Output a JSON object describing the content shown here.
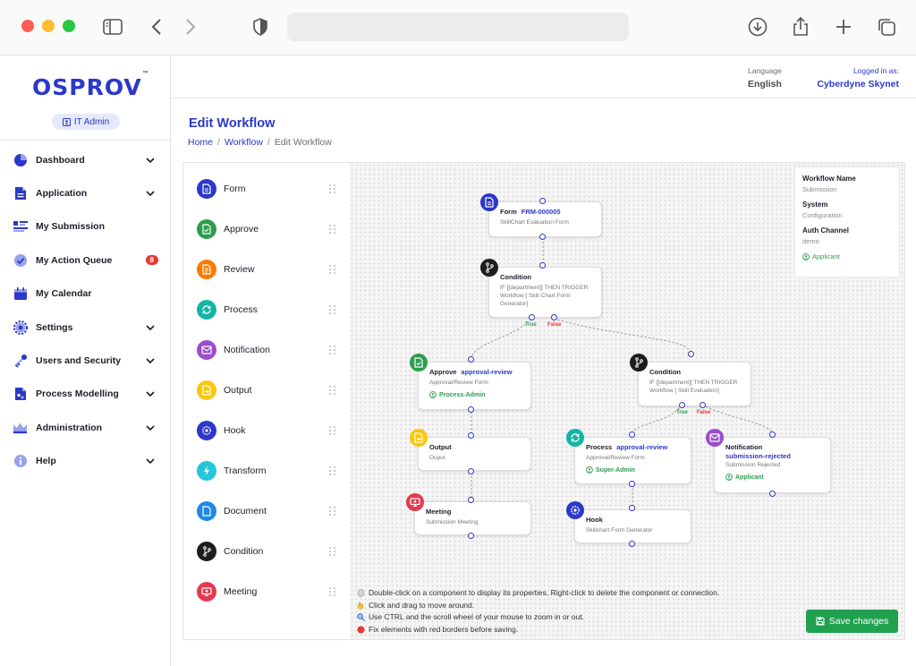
{
  "browser": {
    "icons": [
      "sidebar-icon",
      "back-icon",
      "forward-icon",
      "shield-icon",
      "download-icon",
      "share-icon",
      "new-tab-icon",
      "tabs-icon"
    ]
  },
  "app": {
    "logo": "OSPROV",
    "logo_tm": "™",
    "role": "IT Admin"
  },
  "sidebar": {
    "items": [
      {
        "label": "Dashboard",
        "icon": "pie-chart-icon",
        "chevron": true
      },
      {
        "label": "Application",
        "icon": "document-icon",
        "chevron": true
      },
      {
        "label": "My Submission",
        "icon": "list-icon",
        "chevron": false
      },
      {
        "label": "My Action Queue",
        "icon": "check-circle-icon",
        "badge": "8"
      },
      {
        "label": "My Calendar",
        "icon": "calendar-icon",
        "chevron": false
      },
      {
        "label": "Settings",
        "icon": "gear-icon",
        "chevron": true
      },
      {
        "label": "Users and Security",
        "icon": "key-icon",
        "chevron": true
      },
      {
        "label": "Process Modelling",
        "icon": "flow-icon",
        "chevron": true
      },
      {
        "label": "Administration",
        "icon": "crown-icon",
        "chevron": true
      },
      {
        "label": "Help",
        "icon": "info-icon",
        "chevron": true
      }
    ]
  },
  "header": {
    "language_label": "Language",
    "language_value": "English",
    "logged_label": "Logged in as:",
    "logged_user": "Cyberdyne Skynet"
  },
  "page": {
    "title": "Edit Workflow",
    "breadcrumb": [
      "Home",
      "Workflow",
      "Edit Workflow"
    ]
  },
  "palette": [
    {
      "label": "Form",
      "color": "#2b38c9"
    },
    {
      "label": "Approve",
      "color": "#2e9d4f"
    },
    {
      "label": "Review",
      "color": "#f57c00"
    },
    {
      "label": "Process",
      "color": "#13b5a5"
    },
    {
      "label": "Notification",
      "color": "#9c4dcc"
    },
    {
      "label": "Output",
      "color": "#f9c80e"
    },
    {
      "label": "Hook",
      "color": "#2b38c9"
    },
    {
      "label": "Transform",
      "color": "#26c6da"
    },
    {
      "label": "Document",
      "color": "#1e88e5"
    },
    {
      "label": "Condition",
      "color": "#1d1d1d"
    },
    {
      "label": "Meeting",
      "color": "#e53950"
    }
  ],
  "workflow_info": {
    "name_label": "Workflow Name",
    "name_value": "Submission",
    "system_label": "System",
    "system_value": "Configuration",
    "auth_label": "Auth Channel",
    "auth_value": "demo",
    "applicant": "Applicant"
  },
  "nodes": {
    "form": {
      "title": "Form",
      "code": "FRM-000005",
      "sub": "SkillChart Evaluation Form"
    },
    "cond1": {
      "title": "Condition",
      "sub": "IF [[department]] THEN TRIGGER Workflow [ Skill Chart Form Generator]"
    },
    "approve": {
      "title": "Approve",
      "code": "approval-review",
      "sub": "Approval/Review Form",
      "assignee": "Process-Admin"
    },
    "cond2": {
      "title": "Condition",
      "sub": "IF [[department]] THEN TRIGGER Workflow [ Skill Evaluation]"
    },
    "output": {
      "title": "Output",
      "sub": "Ouput"
    },
    "process": {
      "title": "Process",
      "code": "approval-review",
      "sub": "Approval/Review Form",
      "assignee": "Super-Admin"
    },
    "notification": {
      "title": "Notification",
      "code": "submission-rejected",
      "sub": "Submission Rejected",
      "assignee": "Applicant"
    },
    "meeting": {
      "title": "Meeting",
      "sub": "Submission Meeting"
    },
    "hook": {
      "title": "Hook",
      "sub": "Skillchart Form Generator"
    }
  },
  "port_labels": {
    "true": "True",
    "false": "False"
  },
  "hints": [
    "Double-click on a component to display its properties. Right-click to delete the component or connection.",
    "Click and drag to move around.",
    "Use CTRL and the scroll wheel of your mouse to zoom in or out.",
    "Fix elements with red borders before saving."
  ],
  "actions": {
    "save": "Save changes"
  }
}
